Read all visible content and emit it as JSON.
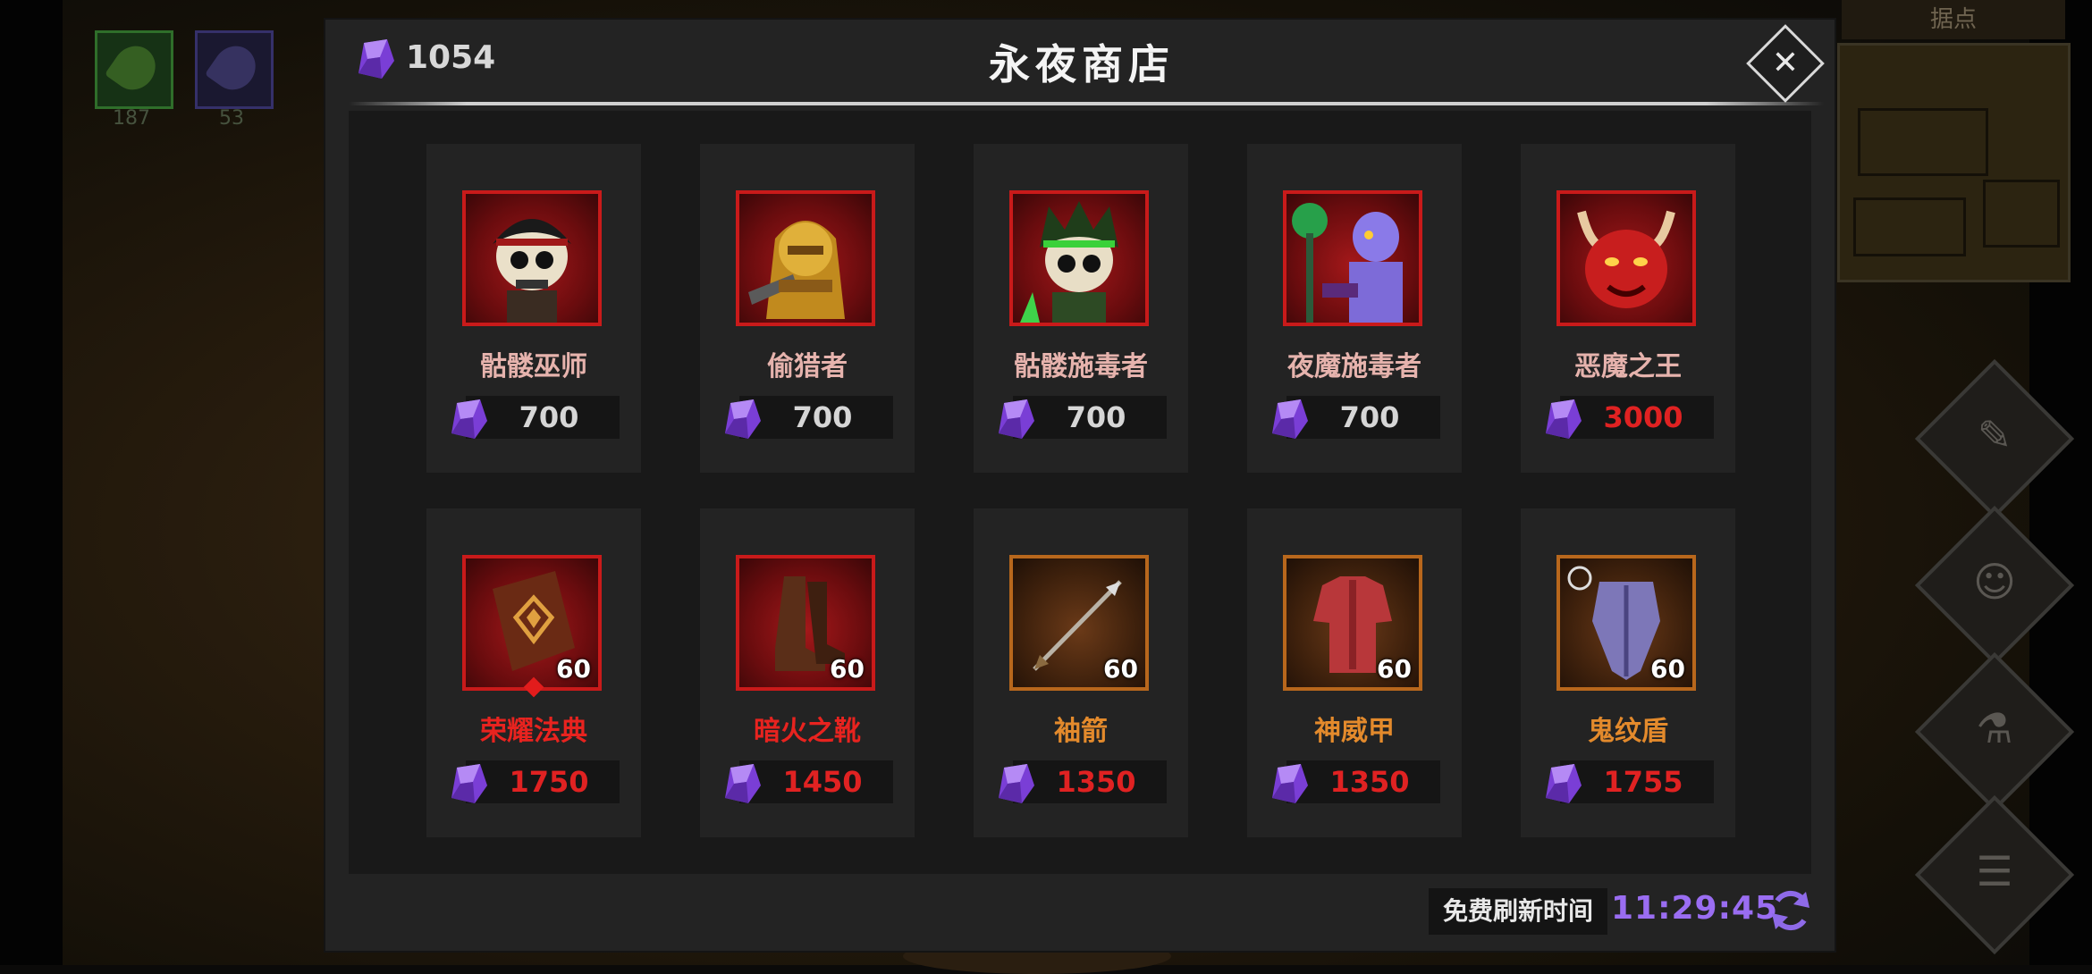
{
  "background": {
    "hud_skills": [
      {
        "icon": "leaf-skill-icon",
        "count": "187"
      },
      {
        "icon": "feather-skill-icon",
        "count": "53"
      }
    ],
    "minimap_title": "据点",
    "side_buttons": [
      {
        "icon": "scroll-icon"
      },
      {
        "icon": "party-icon"
      },
      {
        "icon": "potion-icon"
      },
      {
        "icon": "menu-icon"
      }
    ]
  },
  "shop": {
    "title": "永夜商店",
    "currency": {
      "icon": "purple-gem-icon",
      "amount": "1054"
    },
    "close_icon": "close-icon",
    "items": [
      {
        "name": "骷髅巫师",
        "price": "700",
        "qty": "",
        "name_color": "#e6b3ad",
        "price_color": "#d6d6d6",
        "art": "skeleton-mage"
      },
      {
        "name": "偷猎者",
        "price": "700",
        "qty": "",
        "name_color": "#e6b3ad",
        "price_color": "#d6d6d6",
        "art": "poacher"
      },
      {
        "name": "骷髅施毒者",
        "price": "700",
        "qty": "",
        "name_color": "#e6b3ad",
        "price_color": "#d6d6d6",
        "art": "skeleton-poisoner"
      },
      {
        "name": "夜魔施毒者",
        "price": "700",
        "qty": "",
        "name_color": "#e6b3ad",
        "price_color": "#d6d6d6",
        "art": "night-demon-poisoner"
      },
      {
        "name": "恶魔之王",
        "price": "3000",
        "qty": "",
        "name_color": "#e6b3ad",
        "price_color": "#e02222",
        "art": "demon-king"
      },
      {
        "name": "荣耀法典",
        "price": "1750",
        "qty": "60",
        "name_color": "#e8231f",
        "price_color": "#e02222",
        "art": "glory-codex"
      },
      {
        "name": "暗火之靴",
        "price": "1450",
        "qty": "60",
        "name_color": "#e8231f",
        "price_color": "#e02222",
        "art": "darkfire-boots"
      },
      {
        "name": "袖箭",
        "price": "1350",
        "qty": "60",
        "name_color": "#e38a2c",
        "price_color": "#e02222",
        "art": "sleeve-arrow"
      },
      {
        "name": "神威甲",
        "price": "1350",
        "qty": "60",
        "name_color": "#e38a2c",
        "price_color": "#e02222",
        "art": "divine-armor"
      },
      {
        "name": "鬼纹盾",
        "price": "1755",
        "qty": "60",
        "name_color": "#e38a2c",
        "price_color": "#e02222",
        "art": "ghost-shield"
      }
    ],
    "refresh": {
      "label": "免费刷新时间",
      "time": "11:29:45",
      "icon": "refresh-icon"
    }
  }
}
